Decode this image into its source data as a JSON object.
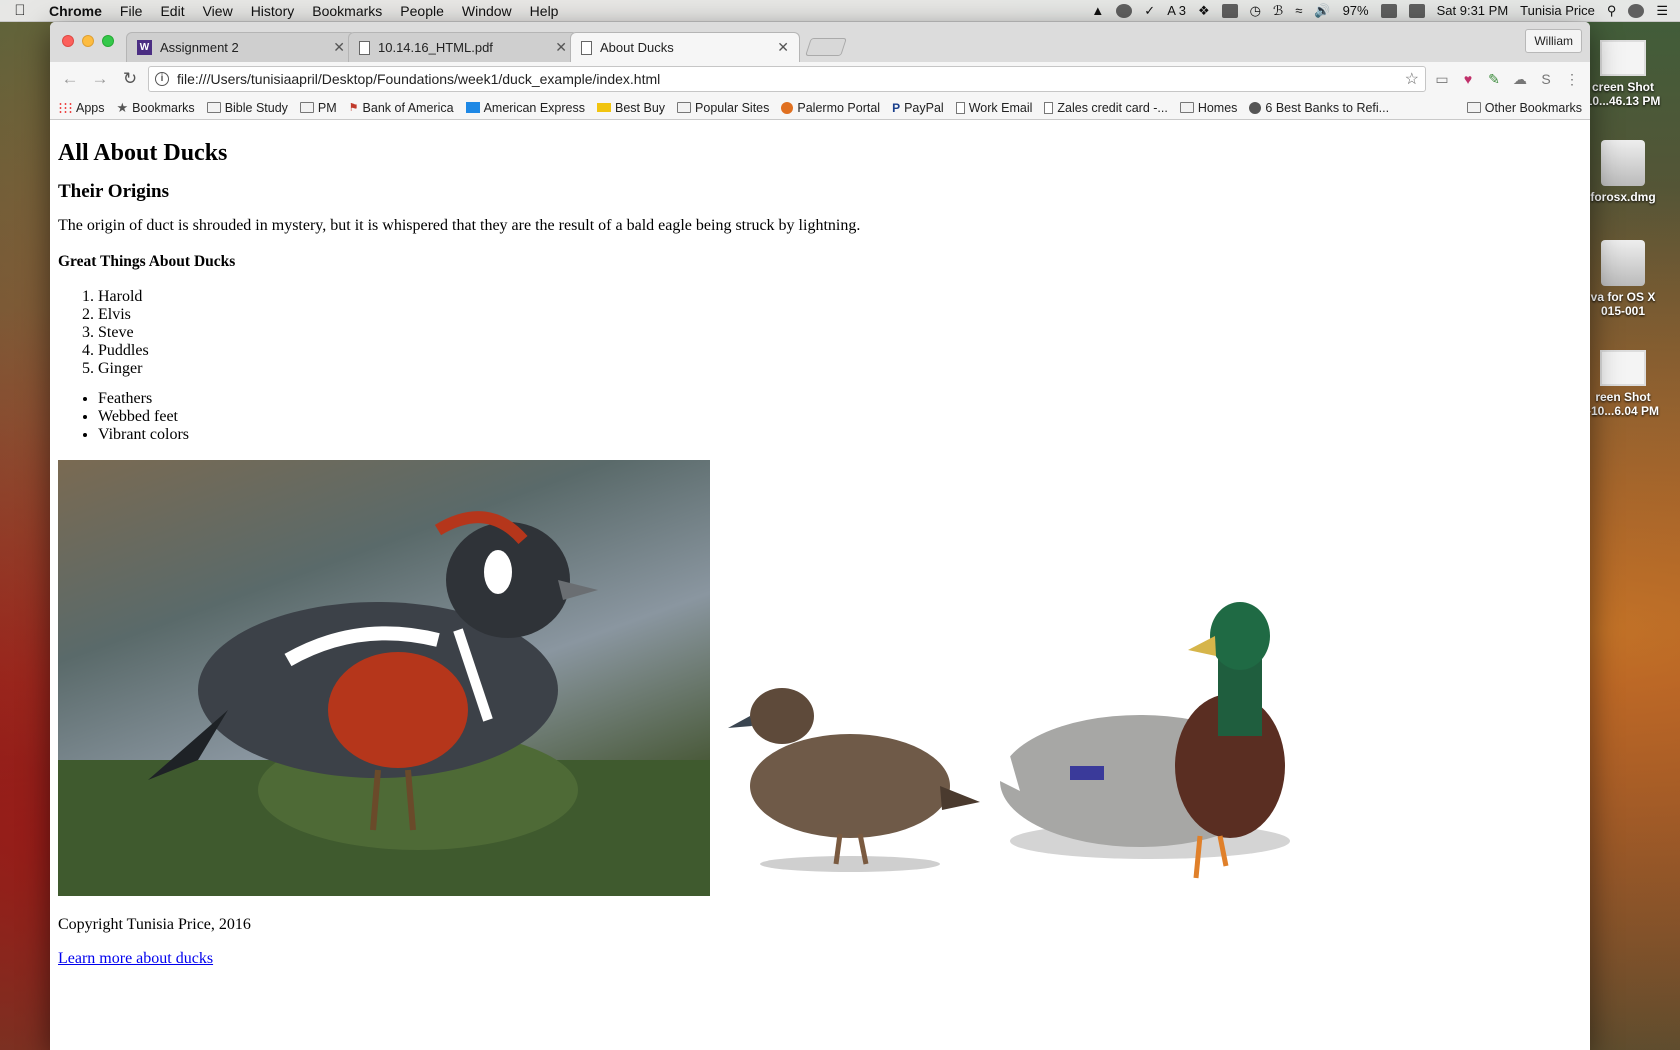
{
  "menubar": {
    "app": "Chrome",
    "items": [
      "File",
      "Edit",
      "View",
      "History",
      "Bookmarks",
      "People",
      "Window",
      "Help"
    ],
    "status": {
      "adobe_count": "3",
      "battery": "97%",
      "clock": "Sat 9:31 PM",
      "user": "Tunisia Price"
    }
  },
  "desktop": {
    "icons": [
      {
        "label": "creen Shot\n10...46.13 PM"
      },
      {
        "label": "forosx.dmg"
      },
      {
        "label": "va for OS X\n015-001"
      },
      {
        "label": "reen Shot\n-10...6.04 PM"
      }
    ]
  },
  "browser": {
    "profile": "William",
    "tabs": [
      {
        "title": "Assignment 2",
        "icon": "w-logo-icon"
      },
      {
        "title": "10.14.16_HTML.pdf",
        "icon": "document-icon"
      },
      {
        "title": "About Ducks",
        "icon": "document-icon",
        "active": true
      }
    ],
    "url": "file:///Users/tunisiaapril/Desktop/Foundations/week1/duck_example/index.html",
    "bookmarks": [
      {
        "label": "Apps",
        "icon": "apps-grid-icon"
      },
      {
        "label": "Bookmarks",
        "icon": "star-icon"
      },
      {
        "label": "Bible Study",
        "icon": "folder-icon"
      },
      {
        "label": "PM",
        "icon": "folder-icon"
      },
      {
        "label": "Bank of America",
        "icon": "bank-icon"
      },
      {
        "label": "American Express",
        "icon": "amex-icon"
      },
      {
        "label": "Best Buy",
        "icon": "bestbuy-icon"
      },
      {
        "label": "Popular Sites",
        "icon": "folder-icon"
      },
      {
        "label": "Palermo Portal",
        "icon": "globe-icon"
      },
      {
        "label": "PayPal",
        "icon": "paypal-icon"
      },
      {
        "label": "Work Email",
        "icon": "document-icon"
      },
      {
        "label": "Zales credit card -...",
        "icon": "document-icon"
      },
      {
        "label": "Homes",
        "icon": "folder-icon"
      },
      {
        "label": "6 Best Banks to Refi...",
        "icon": "shield-icon"
      }
    ],
    "other_bookmarks": "Other Bookmarks"
  },
  "page": {
    "title": "All About Ducks",
    "origins_heading": "Their Origins",
    "origins_text": "The origin of duct is shrouded in mystery, but it is whispered that they are the result of a bald eagle being struck by lightning.",
    "great_heading": "Great Things About Ducks",
    "ordered": [
      "Harold",
      "Elvis",
      "Steve",
      "Puddles",
      "Ginger"
    ],
    "unordered": [
      "Feathers",
      "Webbed feet",
      "Vibrant colors"
    ],
    "copyright": "Copyright Tunisia Price, 2016",
    "link": "Learn more about ducks"
  }
}
